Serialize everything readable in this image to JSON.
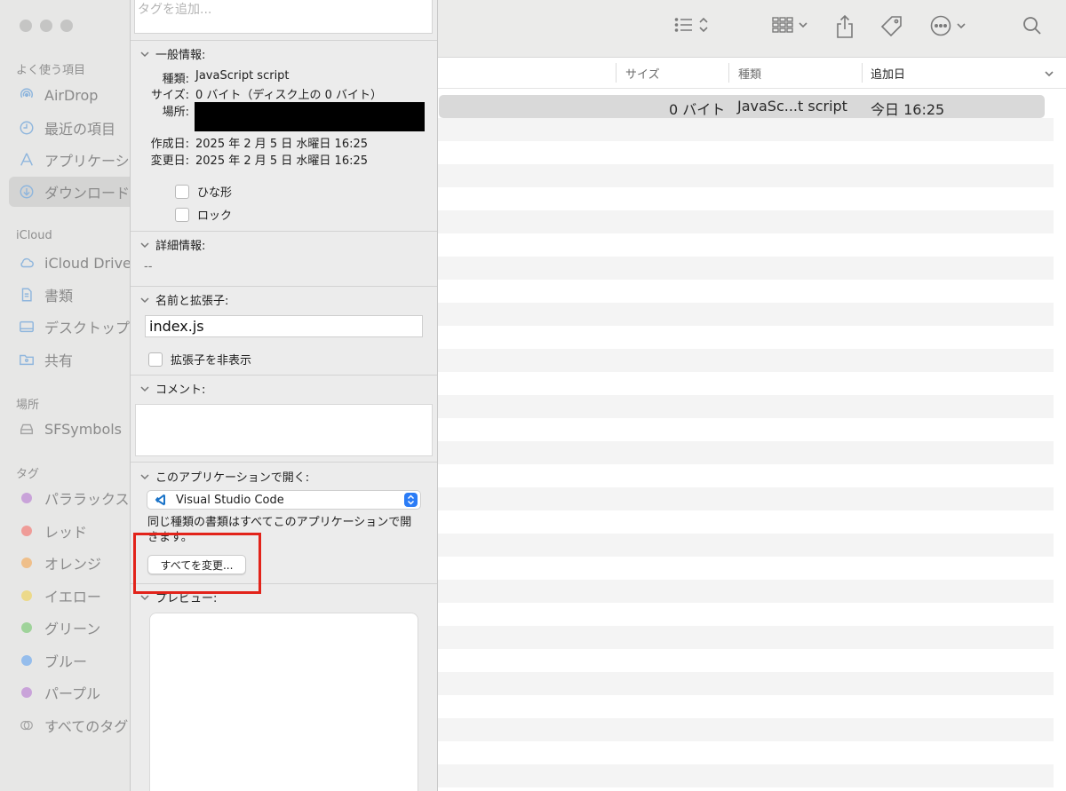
{
  "sidebar": {
    "favorites_title": "よく使う項目",
    "items": [
      {
        "label": "AirDrop",
        "icon": "airdrop-icon"
      },
      {
        "label": "最近の項目",
        "icon": "clock-icon"
      },
      {
        "label": "アプリケーション",
        "icon": "applications-icon"
      },
      {
        "label": "ダウンロード",
        "icon": "download-icon",
        "selected": true
      }
    ],
    "icloud_title": "iCloud",
    "icloud_items": [
      {
        "label": "iCloud Drive",
        "icon": "cloud-icon"
      },
      {
        "label": "書類",
        "icon": "document-icon"
      },
      {
        "label": "デスクトップ",
        "icon": "desktop-icon"
      },
      {
        "label": "共有",
        "icon": "shared-folder-icon"
      }
    ],
    "locations_title": "場所",
    "location_items": [
      {
        "label": "SFSymbols",
        "icon": "disk-icon"
      }
    ],
    "tags_title": "タグ",
    "tags": [
      {
        "label": "パララックス",
        "color": "#c9a3d9"
      },
      {
        "label": "レッド",
        "color": "#ef9c98"
      },
      {
        "label": "オレンジ",
        "color": "#efbf8a"
      },
      {
        "label": "イエロー",
        "color": "#ecd98a"
      },
      {
        "label": "グリーン",
        "color": "#9fd39a"
      },
      {
        "label": "ブルー",
        "color": "#95bdec"
      },
      {
        "label": "パープル",
        "color": "#c9a3d9"
      },
      {
        "label": "すべてのタグ…",
        "color": "none"
      }
    ]
  },
  "info_panel": {
    "tag_placeholder": "タグを追加...",
    "general": {
      "title": "一般情報:",
      "kind_key": "種類:",
      "kind_value": "JavaScript script",
      "size_key": "サイズ:",
      "size_value": "0 バイト（ディスク上の 0 バイト）",
      "where_key": "場所:",
      "created_key": "作成日:",
      "created_value": "2025 年 2 月 5 日 水曜日 16:25",
      "modified_key": "変更日:",
      "modified_value": "2025 年 2 月 5 日 水曜日 16:25",
      "stationery_label": "ひな形",
      "locked_label": "ロック"
    },
    "more_info": {
      "title": "詳細情報:",
      "value": "--"
    },
    "name_ext": {
      "title": "名前と拡張子:",
      "filename": "index.js",
      "hide_ext_label": "拡張子を非表示"
    },
    "comments": {
      "title": "コメント:"
    },
    "open_with": {
      "title": "このアプリケーションで開く:",
      "app": "Visual Studio Code",
      "note": "同じ種類の書類はすべてこのアプリケーションで開きます。",
      "change_all_label": "すべてを変更..."
    },
    "preview": {
      "title": "プレビュー:"
    }
  },
  "list": {
    "columns": [
      "サイズ",
      "種類",
      "追加日"
    ],
    "selected_row": {
      "size": "0 バイト",
      "kind": "JavaSc...t script",
      "date_added": "今日 16:25"
    }
  },
  "colors": {
    "highlight": "#e2231a",
    "accent": "#2b7cf6"
  }
}
